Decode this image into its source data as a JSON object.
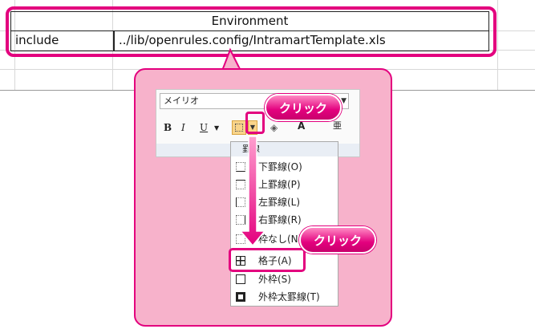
{
  "table": {
    "title": "Environment",
    "rows": [
      {
        "key": "include",
        "value": "../lib/openrules.config/IntramartTemplate.xls"
      }
    ]
  },
  "toolbar": {
    "font_name": "メイリオ",
    "bold": "B",
    "italic": "I",
    "underline": "U",
    "font_color_glyph": "A",
    "phonetic_glyph": "亜"
  },
  "menu": {
    "header": "罫線",
    "items": [
      {
        "label": "下罫線(O)",
        "icon": "bottom-border-icon"
      },
      {
        "label": "上罫線(P)",
        "icon": "top-border-icon"
      },
      {
        "label": "左罫線(L)",
        "icon": "left-border-icon"
      },
      {
        "label": "右罫線(R)",
        "icon": "right-border-icon"
      },
      {
        "label": "枠なし(N)",
        "icon": "no-border-icon"
      },
      {
        "label": "格子(A)",
        "icon": "all-borders-icon"
      },
      {
        "label": "外枠(S)",
        "icon": "outside-border-icon"
      },
      {
        "label": "外枠太罫線(T)",
        "icon": "thick-outside-border-icon"
      }
    ]
  },
  "callouts": {
    "click_1": "クリック",
    "click_2": "クリック"
  },
  "colors": {
    "accent": "#e3007e",
    "callout_bg": "#f7b2cb",
    "button_active": "#f9d48a"
  }
}
